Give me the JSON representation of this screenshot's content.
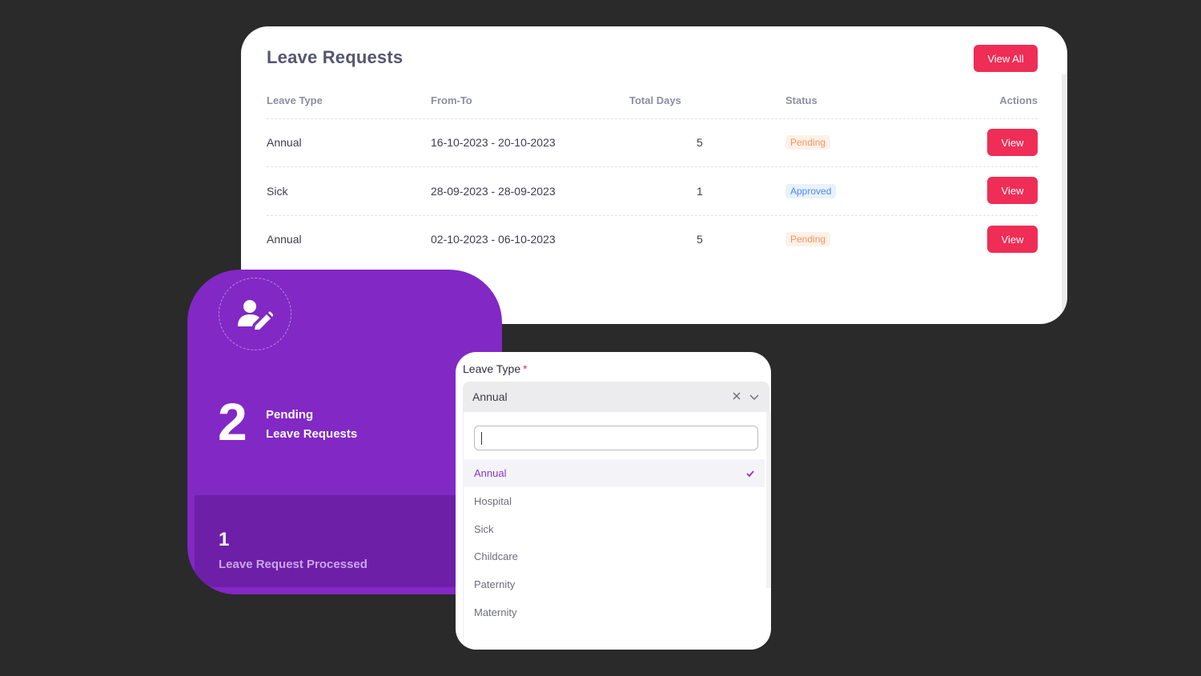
{
  "requests": {
    "title": "Leave Requests",
    "view_all_label": "View All",
    "columns": [
      "Leave Type",
      "From-To",
      "Total Days",
      "Status",
      "Actions"
    ],
    "rows": [
      {
        "type": "Annual",
        "dates": "16-10-2023 - 20-10-2023",
        "days": "5",
        "status": "Pending",
        "action": "View"
      },
      {
        "type": "Sick",
        "dates": "28-09-2023 - 28-09-2023",
        "days": "1",
        "status": "Approved",
        "action": "View"
      },
      {
        "type": "Annual",
        "dates": "02-10-2023 - 06-10-2023",
        "days": "5",
        "status": "Pending",
        "action": "View"
      }
    ]
  },
  "stats": {
    "pending_count": "2",
    "pending_line1": "Pending",
    "pending_line2": "Leave Requests",
    "processed_count": "1",
    "processed_label": "Leave Request Processed",
    "icon": "user-edit-icon"
  },
  "dropdown": {
    "label": "Leave Type",
    "required_mark": "*",
    "selected_value": "Annual",
    "search_value": "",
    "options": [
      "Annual",
      "Hospital",
      "Sick",
      "Childcare",
      "Paternity",
      "Maternity"
    ]
  },
  "colors": {
    "accent_red": "#ef2d56",
    "purple": "#8228c5",
    "pending": "#f0955f",
    "approved": "#4c8bf0"
  }
}
